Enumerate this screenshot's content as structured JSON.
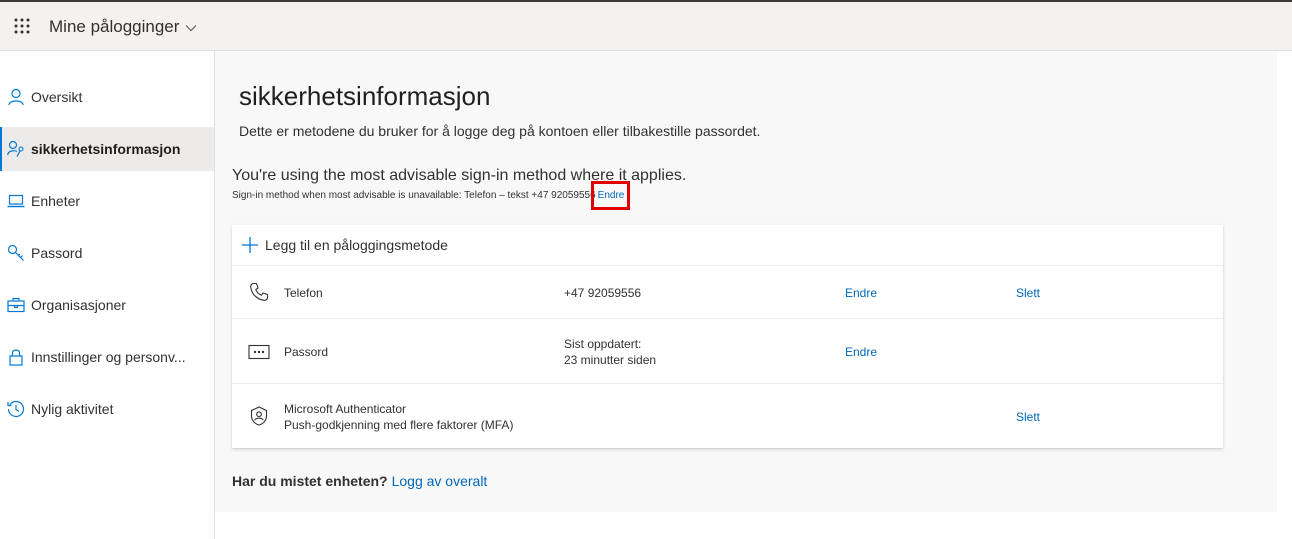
{
  "header": {
    "app_title": "Mine pålogginger",
    "waffle_icon": "waffle-icon",
    "chevron_icon": "chevron-down-icon"
  },
  "sidebar": {
    "items": [
      {
        "label": "Oversikt",
        "icon": "person-icon",
        "active": false
      },
      {
        "label": "sikkerhetsinformasjon",
        "icon": "person-key-icon",
        "active": true
      },
      {
        "label": "Enheter",
        "icon": "laptop-icon",
        "active": false
      },
      {
        "label": "Passord",
        "icon": "key-icon",
        "active": false
      },
      {
        "label": "Organisasjoner",
        "icon": "briefcase-icon",
        "active": false
      },
      {
        "label": "Innstillinger og personv...",
        "icon": "lock-icon",
        "active": false
      },
      {
        "label": "Nylig aktivitet",
        "icon": "history-icon",
        "active": false
      }
    ]
  },
  "main": {
    "title": "sikkerhetsinformasjon",
    "description": "Dette er metodene du bruker for å logge deg på kontoen eller tilbakestille passordet.",
    "advice": "You're using the most advisable sign-in method where it applies.",
    "advice_sub": "Sign-in method when most advisable is unavailable: Telefon – tekst +47 92059556",
    "advice_change_link": "Endre",
    "add_method_label": "Legg til en påloggingsmetode",
    "methods": [
      {
        "icon": "phone-icon",
        "name": "Telefon",
        "name2": "",
        "value": "+47 92059556",
        "value2": "",
        "change": "Endre",
        "delete": "Slett"
      },
      {
        "icon": "password-icon",
        "name": "Passord",
        "name2": "",
        "value": "Sist oppdatert:",
        "value2": "23 minutter siden",
        "change": "Endre",
        "delete": ""
      },
      {
        "icon": "authenticator-icon",
        "name": "Microsoft Authenticator",
        "name2": "Push-godkjenning med flere faktorer (MFA)",
        "value": "",
        "value2": "",
        "change": "",
        "delete": "Slett"
      }
    ],
    "lost_device_question": "Har du mistet enheten?",
    "lost_device_link": "Logg av overalt"
  },
  "colors": {
    "accent": "#0078d4",
    "link": "#0067b8",
    "highlight": "#e00000"
  }
}
